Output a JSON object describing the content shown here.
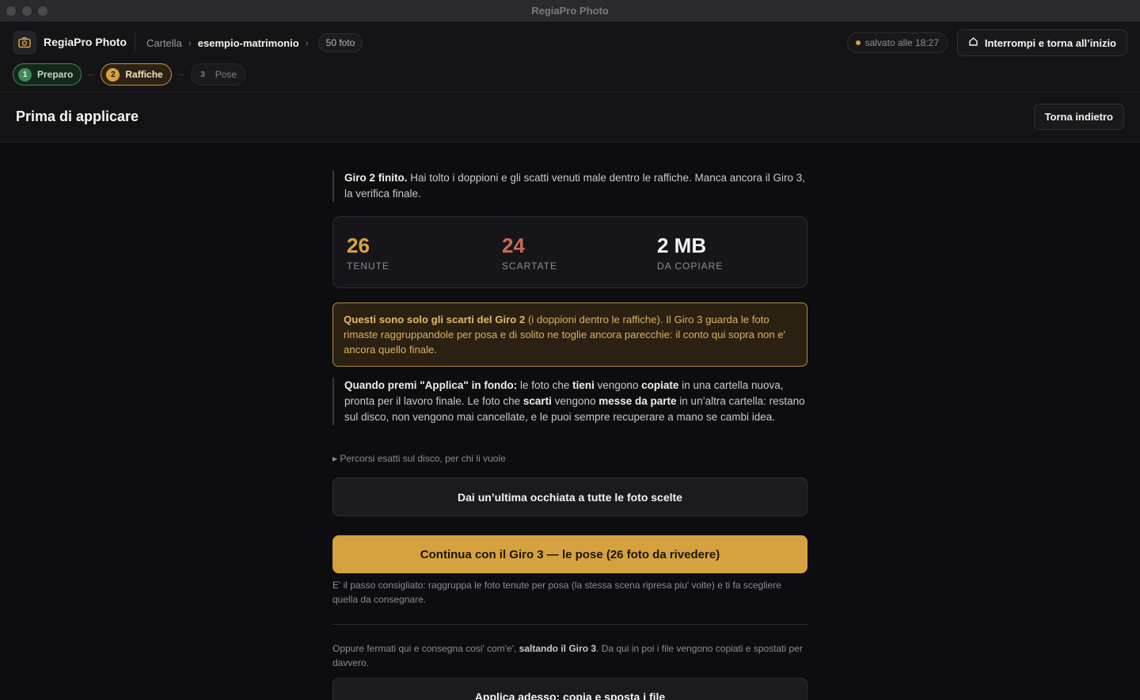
{
  "window": {
    "title": "RegiaPro Photo"
  },
  "header": {
    "app_name": "RegiaPro Photo",
    "breadcrumb": {
      "root": "Cartella",
      "current": "esempio-matrimonio",
      "chevron": "›"
    },
    "photo_count": "50 foto",
    "saved_status": "salvato alle 18:27",
    "interrupt_label": "Interrompi e torna all’inizio"
  },
  "steps": [
    {
      "num": "1",
      "label": "Preparo",
      "state": "done"
    },
    {
      "num": "2",
      "label": "Raffiche",
      "state": "active"
    },
    {
      "num": "3",
      "label": "Pose",
      "state": "todo"
    }
  ],
  "section": {
    "title": "Prima di applicare",
    "back_label": "Torna indietro"
  },
  "intro": {
    "bold": "Giro 2 finito.",
    "text": " Hai tolto i doppioni e gli scatti venuti male dentro le raffiche. Manca ancora il Giro 3, la verifica finale."
  },
  "stats": [
    {
      "value": "26",
      "label": "TENUTE"
    },
    {
      "value": "24",
      "label": "SCARTATE"
    },
    {
      "value": "2 MB",
      "label": "DA COPIARE"
    }
  ],
  "warning": {
    "bold": "Questi sono solo gli scarti del Giro 2",
    "text": " (i doppioni dentro le raffiche). Il Giro 3 guarda le foto rimaste raggruppandole per posa e di solito ne toglie ancora parecchie: il conto qui sopra non e' ancora quello finale."
  },
  "explain": {
    "p1": "Quando premi \"Applica\" in fondo:",
    "p2": " le foto che ",
    "p3": "tieni",
    "p4": " vengono ",
    "p5": "copiate",
    "p6": " in una cartella nuova, pronta per il lavoro finale. Le foto che ",
    "p7": "scarti",
    "p8": " vengono ",
    "p9": "messe da parte",
    "p10": " in un’altra cartella: restano sul disco, non vengono mai cancellate, e le puoi sempre recuperare a mano se cambi idea."
  },
  "details_toggle": "▸ Percorsi esatti sul disco, per chi li vuole",
  "review_button": "Dai un’ultima occhiata a tutte le foto scelte",
  "continue_button": "Continua con il Giro 3 — le pose (26 foto da rivedere)",
  "continue_hint": "E' il passo consigliato: raggruppa le foto tenute per posa (la stessa scena ripresa piu' volte) e ti fa scegliere quella da consegnare.",
  "alternative": {
    "t1": "Oppure fermati qui e consegna cosi' com'e', ",
    "bold": "saltando il Giro 3",
    "t2": ". Da qui in poi i file vengono copiati e spostati per davvero."
  },
  "apply_button": "Applica adesso: copia e sposta i file",
  "colors": {
    "accent": "#d6a23f",
    "success": "#3d8a56",
    "danger": "#c96a55"
  }
}
